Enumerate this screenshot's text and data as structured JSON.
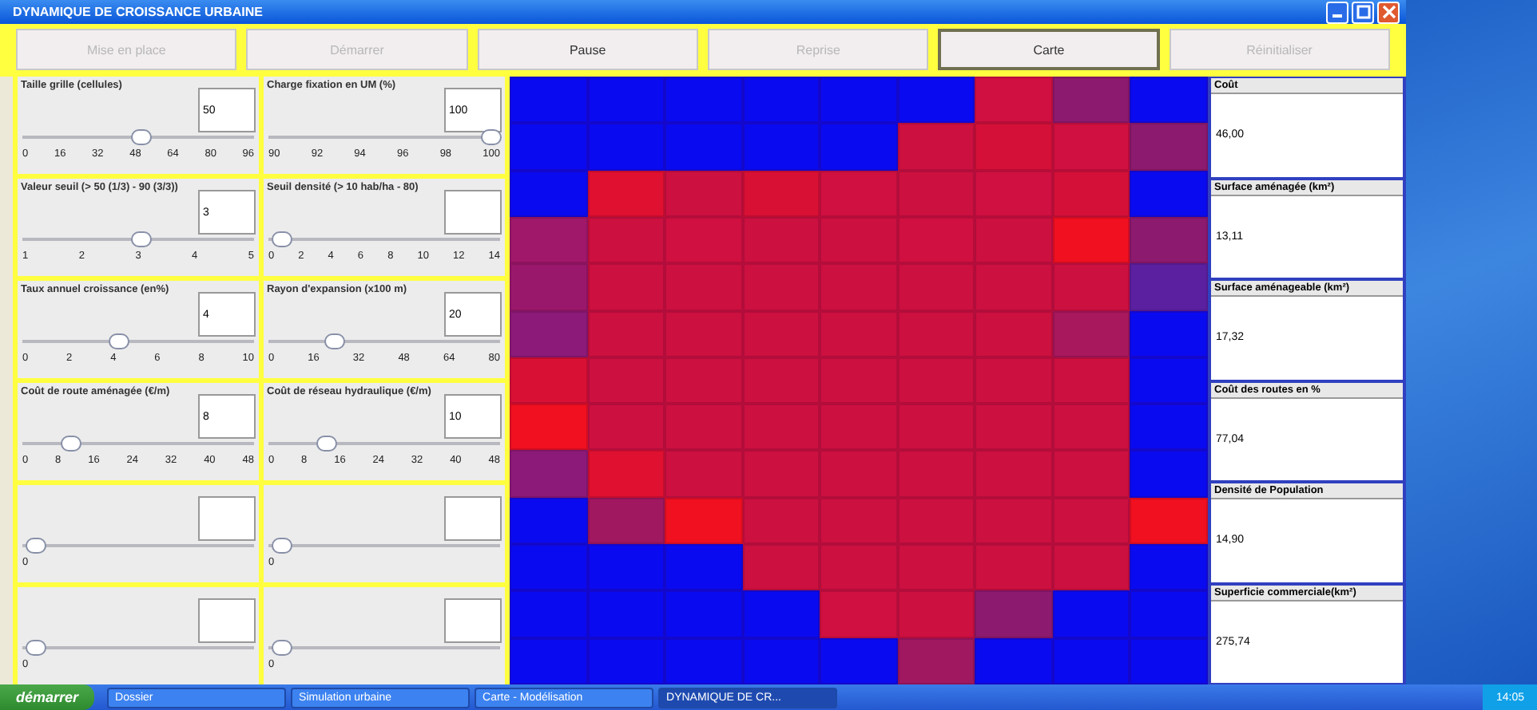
{
  "window": {
    "title": "DYNAMIQUE DE CROISSANCE URBAINE"
  },
  "toolbar": [
    {
      "label": "Mise en place",
      "disabled": true,
      "selected": false
    },
    {
      "label": "Démarrer",
      "disabled": true,
      "selected": false
    },
    {
      "label": "Pause",
      "disabled": false,
      "selected": false
    },
    {
      "label": "Reprise",
      "disabled": true,
      "selected": false
    },
    {
      "label": "Carte",
      "disabled": false,
      "selected": true
    },
    {
      "label": "Réinitialiser",
      "disabled": true,
      "selected": false
    }
  ],
  "parameters": [
    {
      "label": "Taille grille (cellules)",
      "value": "50",
      "level": 0.5,
      "ticks": [
        "0",
        "16",
        "32",
        "48",
        "64",
        "80",
        "96"
      ]
    },
    {
      "label": "Charge fixation en UM (%)",
      "value": "100",
      "level": 1,
      "ticks": [
        "90",
        "92",
        "94",
        "96",
        "98",
        "100"
      ]
    },
    {
      "label": "Valeur seuil (> 50 (1/3) - 90 (3/3))",
      "value": "3",
      "level": 0.5,
      "ticks": [
        "1",
        "2",
        "3",
        "4",
        "5"
      ]
    },
    {
      "label": "Seuil densité (> 10 hab/ha - 80)",
      "level": 0,
      "ticks": [
        "0",
        "2",
        "4",
        "6",
        "8",
        "10",
        "12",
        "14"
      ]
    },
    {
      "label": "Taux annuel croissance (en%)",
      "value": "4",
      "level": 0.4,
      "ticks": [
        "0",
        "2",
        "4",
        "6",
        "8",
        "10"
      ]
    },
    {
      "label": "Rayon d'expansion (x100 m)",
      "value": "20",
      "level": 0.25,
      "ticks": [
        "0",
        "16",
        "32",
        "48",
        "64",
        "80"
      ]
    },
    {
      "label": "Coût de route aménagée (€/m)",
      "value": "8",
      "level": 0.17,
      "ticks": [
        "0",
        "8",
        "16",
        "24",
        "32",
        "40",
        "48"
      ]
    },
    {
      "label": "Coût de réseau hydraulique (€/m)",
      "value": "10",
      "level": 0.21,
      "ticks": [
        "0",
        "8",
        "16",
        "24",
        "32",
        "40",
        "48"
      ]
    },
    {
      "level": 0,
      "ticks": [
        "0"
      ]
    },
    {
      "level": 0,
      "ticks": [
        "0"
      ]
    },
    {
      "level": 0,
      "ticks": [
        "0"
      ]
    },
    {
      "level": 0,
      "ticks": [
        "0"
      ]
    }
  ],
  "grid": {
    "rows": [
      {
        "cells": [
          {
            "color": "#0a0af0"
          },
          {
            "color": "#0a0af0"
          },
          {
            "color": "#0a0af0"
          },
          {
            "color": "#0a0af0"
          },
          {
            "color": "#0a0af0"
          },
          {
            "color": "#0a0af0"
          },
          {
            "color": "#d01040"
          },
          {
            "color": "#8c1a6e"
          },
          {
            "color": "#0a0af0"
          }
        ]
      },
      {
        "cells": [
          {
            "color": "#0a0af0"
          },
          {
            "color": "#0a0af0"
          },
          {
            "color": "#0a0af0"
          },
          {
            "color": "#0a0af0"
          },
          {
            "color": "#0a0af0"
          },
          {
            "color": "#cc1040"
          },
          {
            "color": "#d41038"
          },
          {
            "color": "#d01040"
          },
          {
            "color": "#8c1a6e"
          }
        ]
      },
      {
        "cells": [
          {
            "color": "#0a0af0"
          },
          {
            "color": "#e01030"
          },
          {
            "color": "#cc1040"
          },
          {
            "color": "#d81034"
          },
          {
            "color": "#d01040"
          },
          {
            "color": "#cc1040"
          },
          {
            "color": "#d01040"
          },
          {
            "color": "#d41038"
          },
          {
            "color": "#0a0af0"
          }
        ]
      },
      {
        "cells": [
          {
            "color": "#a0186a"
          },
          {
            "color": "#cc1040"
          },
          {
            "color": "#d01040"
          },
          {
            "color": "#cc1040"
          },
          {
            "color": "#cc1040"
          },
          {
            "color": "#d01040"
          },
          {
            "color": "#cc1040"
          },
          {
            "color": "#f01020"
          },
          {
            "color": "#8c1a6e"
          }
        ]
      },
      {
        "cells": [
          {
            "color": "#9a186c"
          },
          {
            "color": "#cc1040"
          },
          {
            "color": "#cc1040"
          },
          {
            "color": "#cc1040"
          },
          {
            "color": "#cc1040"
          },
          {
            "color": "#cc1040"
          },
          {
            "color": "#cc1040"
          },
          {
            "color": "#cc1040"
          },
          {
            "color": "#5a20a0"
          }
        ]
      },
      {
        "cells": [
          {
            "color": "#8c1a78"
          },
          {
            "color": "#cc1040"
          },
          {
            "color": "#cc1040"
          },
          {
            "color": "#cc1040"
          },
          {
            "color": "#cc1040"
          },
          {
            "color": "#cc1040"
          },
          {
            "color": "#cc1040"
          },
          {
            "color": "#a8185c"
          },
          {
            "color": "#0a0af0"
          }
        ]
      },
      {
        "cells": [
          {
            "color": "#d81034"
          },
          {
            "color": "#cc1040"
          },
          {
            "color": "#cc1040"
          },
          {
            "color": "#cc1040"
          },
          {
            "color": "#cc1040"
          },
          {
            "color": "#cc1040"
          },
          {
            "color": "#cc1040"
          },
          {
            "color": "#cc1040"
          },
          {
            "color": "#0a0af0"
          }
        ]
      },
      {
        "cells": [
          {
            "color": "#f01020"
          },
          {
            "color": "#cc1040"
          },
          {
            "color": "#cc1040"
          },
          {
            "color": "#cc1040"
          },
          {
            "color": "#cc1040"
          },
          {
            "color": "#cc1040"
          },
          {
            "color": "#cc1040"
          },
          {
            "color": "#cc1040"
          },
          {
            "color": "#0a0af0"
          }
        ]
      },
      {
        "cells": [
          {
            "color": "#8c1a78"
          },
          {
            "color": "#e01030"
          },
          {
            "color": "#cc1040"
          },
          {
            "color": "#cc1040"
          },
          {
            "color": "#cc1040"
          },
          {
            "color": "#cc1040"
          },
          {
            "color": "#cc1040"
          },
          {
            "color": "#cc1040"
          },
          {
            "color": "#0a0af0"
          }
        ]
      },
      {
        "cells": [
          {
            "color": "#0a0af0"
          },
          {
            "color": "#a01860"
          },
          {
            "color": "#f01020"
          },
          {
            "color": "#cc1040"
          },
          {
            "color": "#cc1040"
          },
          {
            "color": "#cc1040"
          },
          {
            "color": "#cc1040"
          },
          {
            "color": "#cc1040"
          },
          {
            "color": "#f01020"
          }
        ]
      },
      {
        "cells": [
          {
            "color": "#0a0af0"
          },
          {
            "color": "#0a0af0"
          },
          {
            "color": "#0a0af0"
          },
          {
            "color": "#cc1040"
          },
          {
            "color": "#cc1040"
          },
          {
            "color": "#cc1040"
          },
          {
            "color": "#cc1040"
          },
          {
            "color": "#cc1040"
          },
          {
            "color": "#0a0af0"
          }
        ]
      },
      {
        "cells": [
          {
            "color": "#0a0af0"
          },
          {
            "color": "#0a0af0"
          },
          {
            "color": "#0a0af0"
          },
          {
            "color": "#0a0af0"
          },
          {
            "color": "#d01040"
          },
          {
            "color": "#cc1040"
          },
          {
            "color": "#8c1a6e"
          },
          {
            "color": "#0a0af0"
          },
          {
            "color": "#0a0af0"
          }
        ]
      },
      {
        "cells": [
          {
            "color": "#0a0af0"
          },
          {
            "color": "#0a0af0"
          },
          {
            "color": "#0a0af0"
          },
          {
            "color": "#0a0af0"
          },
          {
            "color": "#0a0af0"
          },
          {
            "color": "#a01860"
          },
          {
            "color": "#0a0af0"
          },
          {
            "color": "#0a0af0"
          },
          {
            "color": "#0a0af0"
          }
        ]
      }
    ]
  },
  "results": [
    {
      "label": "Coût",
      "value": "46,00"
    },
    {
      "label": "Surface aménagée (km²)",
      "value": "13,11"
    },
    {
      "label": "Surface aménageable (km²)",
      "value": "17,32"
    },
    {
      "label": "Coût des routes en %",
      "value": "77,04"
    },
    {
      "label": "Densité de Population",
      "value": "14,90"
    },
    {
      "label": "Superficie commerciale(km²)",
      "value": "275,74"
    }
  ],
  "taskbar": {
    "start": "démarrer",
    "tasks": [
      {
        "label": "Dossier",
        "selected": false
      },
      {
        "label": "Simulation urbaine",
        "selected": false
      },
      {
        "label": "Carte - Modélisation",
        "selected": false
      },
      {
        "label": "DYNAMIQUE DE CR...",
        "selected": true
      }
    ],
    "clock": "14:05"
  }
}
